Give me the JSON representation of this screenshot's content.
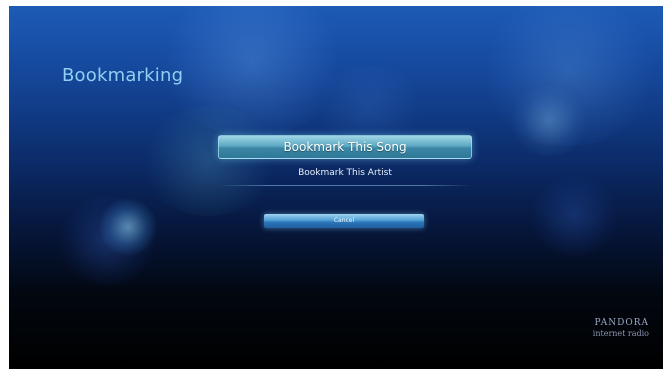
{
  "page": {
    "title": "Bookmarking"
  },
  "menu": {
    "items": [
      {
        "label": "Bookmark This Song",
        "selected": true
      },
      {
        "label": "Bookmark This Artist",
        "selected": false
      }
    ]
  },
  "actions": {
    "cancel_label": "Cancel"
  },
  "brand": {
    "name": "PANDORA",
    "tagline": "internet radio"
  },
  "colors": {
    "title": "#8fd0f2",
    "highlight": "#5da9c2",
    "button": "#2a74b8"
  }
}
